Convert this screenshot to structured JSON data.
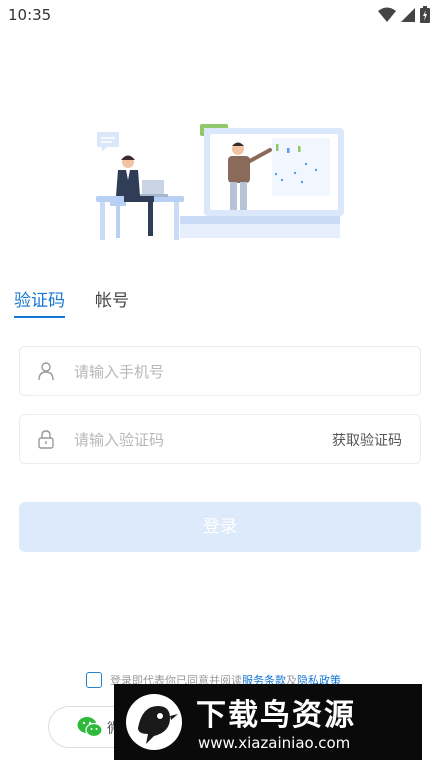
{
  "status_bar": {
    "time": "10:35"
  },
  "tabs": [
    {
      "label": "验证码",
      "active": true
    },
    {
      "label": "帐号",
      "active": false
    }
  ],
  "phone_field": {
    "placeholder": "请输入手机号",
    "value": ""
  },
  "code_field": {
    "placeholder": "请输入验证码",
    "value": "",
    "action_label": "获取验证码"
  },
  "login_button": {
    "label": "登录"
  },
  "agreement": {
    "prefix": "登录即代表你已同意并阅读",
    "terms_link": "服务条款",
    "conjunction": "及",
    "privacy_link": "隐私政策",
    "checked": false
  },
  "wechat_button": {
    "label": "微"
  },
  "watermark": {
    "title": "下载鸟资源",
    "url": "www.xiazainiao.com"
  },
  "colors": {
    "accent": "#1677d2",
    "login_button_bg": "#dceafb",
    "field_border": "#ececec",
    "wechat_green": "#2dba3c"
  }
}
